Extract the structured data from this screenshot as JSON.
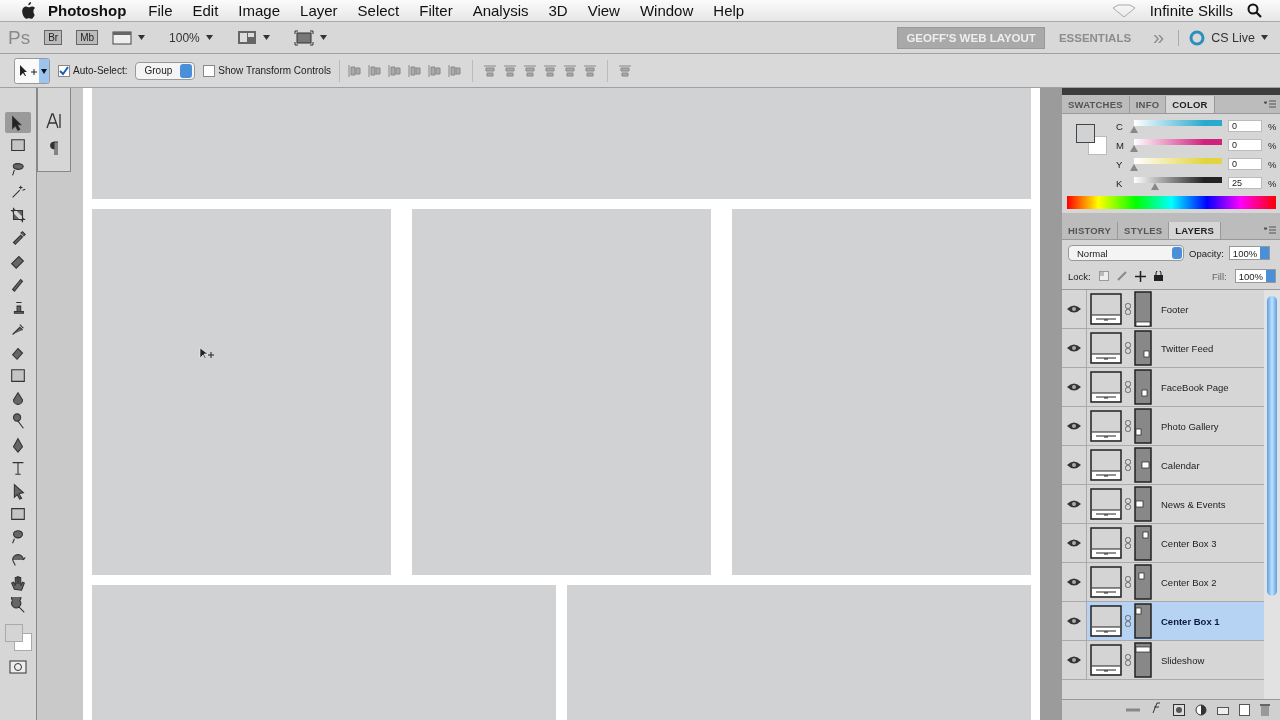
{
  "menu_bar": {
    "app_name": "Photoshop",
    "items": [
      "File",
      "Edit",
      "Image",
      "Layer",
      "Select",
      "Filter",
      "Analysis",
      "3D",
      "View",
      "Window",
      "Help"
    ],
    "extra": "Infinite Skills"
  },
  "app_bar": {
    "logo": "Ps",
    "bridge": "Br",
    "mini_bridge": "Mb",
    "zoom": "100%",
    "workspaces": [
      {
        "label": "GEOFF'S WEB LAYOUT",
        "selected": true
      },
      {
        "label": "ESSENTIALS",
        "selected": false
      }
    ],
    "more": "»",
    "cs_live": "CS Live"
  },
  "options_bar": {
    "auto_select": {
      "label": "Auto-Select:",
      "checked": true
    },
    "auto_select_mode": "Group",
    "transform_controls": {
      "label": "Show Transform Controls",
      "checked": false
    }
  },
  "tools": [
    {
      "selected": true
    },
    {
      "selected": false
    },
    {
      "selected": false
    },
    {
      "selected": false
    },
    {
      "selected": false
    },
    {
      "selected": false
    },
    {
      "selected": false
    },
    {
      "selected": false
    },
    {
      "selected": false
    },
    {
      "selected": false
    },
    {
      "selected": false
    },
    {
      "selected": false
    },
    {
      "selected": false
    },
    {
      "selected": false
    },
    {
      "selected": false
    },
    {
      "selected": false
    },
    {
      "selected": false
    },
    {
      "selected": false
    },
    {
      "selected": false
    },
    {
      "selected": false
    },
    {
      "selected": false
    },
    {
      "selected": false
    }
  ],
  "color_panel": {
    "tabs": [
      {
        "label": "SWATCHES",
        "selected": false
      },
      {
        "label": "INFO",
        "selected": false
      },
      {
        "label": "COLOR",
        "selected": true
      }
    ],
    "sliders": [
      {
        "label": "C",
        "value": "0",
        "level": 0,
        "color": "#2aa9d0"
      },
      {
        "label": "M",
        "value": "0",
        "level": 0,
        "color": "#d0217e"
      },
      {
        "label": "Y",
        "value": "0",
        "level": 0,
        "color": "#e2d440"
      },
      {
        "label": "K",
        "value": "25",
        "level": 0.25,
        "color": "#222222"
      }
    ],
    "unit": "%"
  },
  "layers_panel": {
    "tabs": [
      {
        "label": "HISTORY",
        "selected": false
      },
      {
        "label": "STYLES",
        "selected": false
      },
      {
        "label": "LAYERS",
        "selected": true
      }
    ],
    "blend_mode": "Normal",
    "opacity_label": "Opacity:",
    "opacity": "100%",
    "lock_label": "Lock:",
    "fill_label": "Fill:",
    "fill": "100%",
    "layers": [
      {
        "name": "Footer",
        "visible": true,
        "selected": false
      },
      {
        "name": "Twitter Feed",
        "visible": true,
        "selected": false
      },
      {
        "name": "FaceBook Page",
        "visible": true,
        "selected": false
      },
      {
        "name": "Photo Gallery",
        "visible": true,
        "selected": false
      },
      {
        "name": "Calendar",
        "visible": true,
        "selected": false
      },
      {
        "name": "News & Events",
        "visible": true,
        "selected": false
      },
      {
        "name": "Center Box 3",
        "visible": true,
        "selected": false
      },
      {
        "name": "Center Box 2",
        "visible": true,
        "selected": false
      },
      {
        "name": "Center Box 1",
        "visible": true,
        "selected": true
      },
      {
        "name": "Slideshow",
        "visible": true,
        "selected": false
      }
    ]
  }
}
